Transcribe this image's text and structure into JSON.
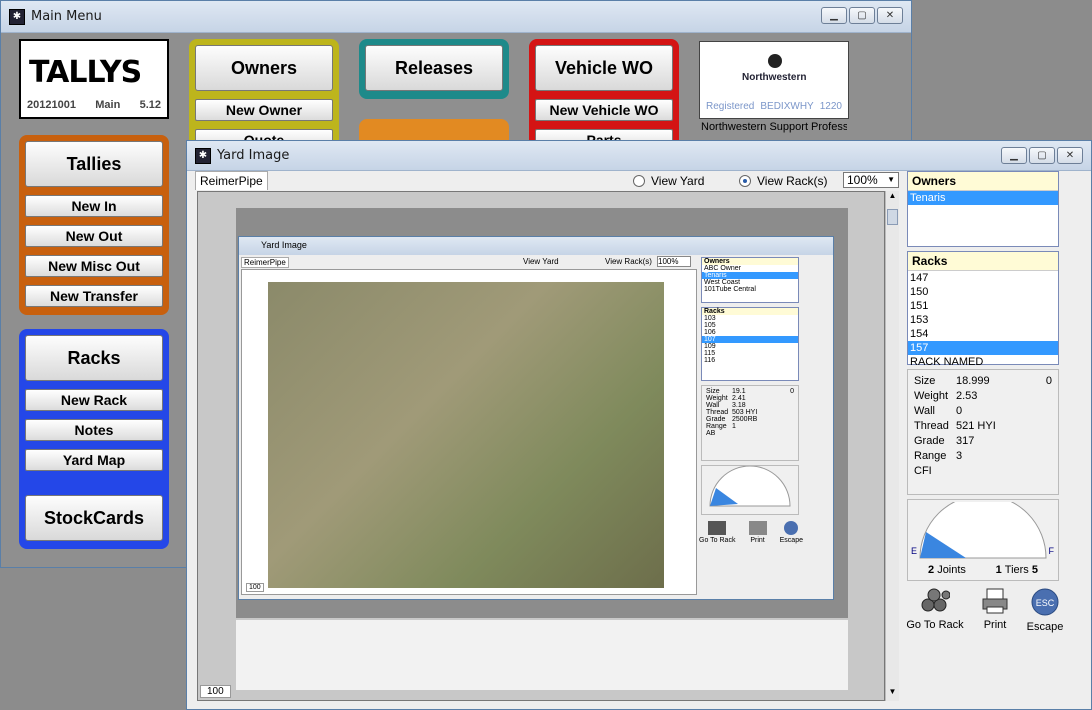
{
  "main_window": {
    "title": "Main Menu",
    "logo": {
      "brand": "TALLYS",
      "version_code": "20121001",
      "mode": "Main",
      "version": "5.12"
    },
    "owners_group": {
      "title": "Owners",
      "items": [
        "New Owner",
        "Quote"
      ]
    },
    "releases_group": {
      "title": "Releases"
    },
    "vehicle_group": {
      "title": "Vehicle WO",
      "items": [
        "New Vehicle WO",
        "Parts"
      ]
    },
    "tallies_group": {
      "title": "Tallies",
      "items": [
        "New In",
        "New Out",
        "New Misc Out",
        "New Transfer"
      ]
    },
    "racks_group": {
      "title": "Racks",
      "items": [
        "New Rack",
        "Notes",
        "Yard Map"
      ],
      "footer": "StockCards"
    },
    "company": {
      "logo_text": "Northwestern",
      "registered_label": "Registered",
      "registered_code": "BEDIXWHY",
      "registered_num": "1220",
      "caption": "Northwestern Support Profess"
    }
  },
  "yard_window": {
    "title": "Yard Image",
    "tab": "ReimerPipe",
    "view_yard": "View Yard",
    "view_racks": "View Rack(s)",
    "zoom": "100%",
    "page_number": "100",
    "owners": {
      "header": "Owners",
      "items": [
        "Tenaris"
      ],
      "selected": "Tenaris"
    },
    "racks": {
      "header": "Racks",
      "items": [
        "147",
        "150",
        "151",
        "153",
        "154",
        "157",
        "RACK NAMED"
      ],
      "selected": "157"
    },
    "details": [
      {
        "label": "Size",
        "value": "18.999"
      },
      {
        "label": "Weight",
        "value": "2.53"
      },
      {
        "label": "Wall",
        "value": "0"
      },
      {
        "label": "Thread",
        "value": "521 HYI"
      },
      {
        "label": "Grade",
        "value": "317"
      },
      {
        "label": "Range",
        "value": "3"
      },
      {
        "label": "CFI",
        "value": ""
      }
    ],
    "detail_count": "0",
    "gauge": {
      "empty_label": "E",
      "full_label": "F",
      "joints_value": "2",
      "joints_label": "Joints",
      "tiers_num": "1",
      "tiers_label": "Tiers",
      "tiers_value": "5",
      "fill_fraction": 0.22
    },
    "tools": [
      "Go To Rack",
      "Print",
      "Escape"
    ],
    "escape_icon_text": "ESC"
  },
  "inner_window": {
    "title": "Yard Image",
    "tab": "ReimerPipe",
    "view_yard": "View Yard",
    "view_racks": "View Rack(s)",
    "zoom": "100%",
    "owners_header": "Owners",
    "owners": [
      "ABC Owner",
      "Tenaris",
      "West Coast",
      "101Tube Central"
    ],
    "owners_selected": "Tenaris",
    "racks_header": "Racks",
    "racks": [
      "103",
      "105",
      "106",
      "107",
      "109",
      "115",
      "116"
    ],
    "racks_selected": "107",
    "details": [
      {
        "label": "Size",
        "value": "19.1"
      },
      {
        "label": "Weight",
        "value": "2.41"
      },
      {
        "label": "Wall",
        "value": "3.18"
      },
      {
        "label": "Thread",
        "value": "503 HYI"
      },
      {
        "label": "Grade",
        "value": "2500RB"
      },
      {
        "label": "Range",
        "value": "1"
      },
      {
        "label": "AB",
        "value": ""
      }
    ],
    "detail_count": "0",
    "page_number": "100"
  },
  "colors": {
    "owners_border": "#bdb51c",
    "releases_border": "#1e8a8a",
    "vehicle_border": "#d41414",
    "tallies_border": "#c8600e",
    "racks_border": "#2447e8",
    "list_selected": "#3399ff"
  }
}
